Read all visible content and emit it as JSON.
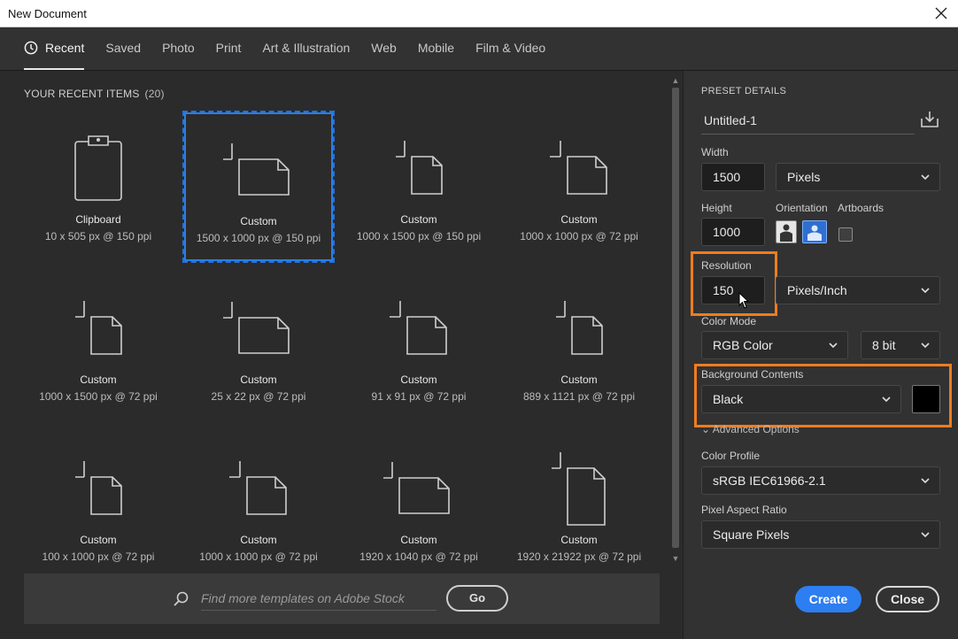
{
  "window": {
    "title": "New Document"
  },
  "tabs": [
    {
      "label": "Recent",
      "active": true
    },
    {
      "label": "Saved"
    },
    {
      "label": "Photo"
    },
    {
      "label": "Print"
    },
    {
      "label": "Art & Illustration"
    },
    {
      "label": "Web"
    },
    {
      "label": "Mobile"
    },
    {
      "label": "Film & Video"
    }
  ],
  "recent": {
    "heading": "YOUR RECENT ITEMS",
    "count": "(20)",
    "items": [
      {
        "name": "Clipboard",
        "meta": "10 x 505 px @ 150 ppi",
        "icon": "clipboard-icon"
      },
      {
        "name": "Custom",
        "meta": "1500 x 1000 px @ 150 ppi",
        "icon": "landscape-doc-icon",
        "selected": true
      },
      {
        "name": "Custom",
        "meta": "1000 x 1500 px @ 150 ppi",
        "icon": "portrait-doc-icon"
      },
      {
        "name": "Custom",
        "meta": "1000 x 1000 px @ 72 ppi",
        "icon": "square-doc-icon"
      },
      {
        "name": "Custom",
        "meta": "1000 x 1500 px @ 72 ppi",
        "icon": "portrait-doc-icon"
      },
      {
        "name": "Custom",
        "meta": "25 x 22 px @ 72 ppi",
        "icon": "landscape-doc-icon"
      },
      {
        "name": "Custom",
        "meta": "91 x 91 px @ 72 ppi",
        "icon": "square-doc-icon"
      },
      {
        "name": "Custom",
        "meta": "889 x 1121 px @ 72 ppi",
        "icon": "portrait-doc-icon"
      },
      {
        "name": "Custom",
        "meta": "100 x 1000 px @ 72 ppi",
        "icon": "portrait-doc-icon"
      },
      {
        "name": "Custom",
        "meta": "1000 x 1000 px @ 72 ppi",
        "icon": "square-doc-icon"
      },
      {
        "name": "Custom",
        "meta": "1920 x 1040 px @ 72 ppi",
        "icon": "landscape-doc-icon"
      },
      {
        "name": "Custom",
        "meta": "1920 x 21922 px @ 72 ppi",
        "icon": "tall-doc-icon"
      }
    ]
  },
  "search": {
    "placeholder": "Find more templates on Adobe Stock",
    "go_label": "Go"
  },
  "preset": {
    "heading": "PRESET DETAILS",
    "doc_name": "Untitled-1",
    "width_label": "Width",
    "width_value": "1500",
    "width_unit": "Pixels",
    "height_label": "Height",
    "height_value": "1000",
    "orientation_label": "Orientation",
    "artboards_label": "Artboards",
    "resolution_label": "Resolution",
    "resolution_value": "150",
    "resolution_unit": "Pixels/Inch",
    "color_mode_label": "Color Mode",
    "color_mode_value": "RGB Color",
    "bit_depth_value": "8 bit",
    "background_label": "Background Contents",
    "background_value": "Black",
    "background_swatch": "#000000",
    "advanced_label": "Advanced Options",
    "color_profile_label": "Color Profile",
    "color_profile_value": "sRGB IEC61966-2.1",
    "pixel_aspect_label": "Pixel Aspect Ratio",
    "pixel_aspect_value": "Square Pixels"
  },
  "actions": {
    "create_label": "Create",
    "close_label": "Close"
  },
  "colors": {
    "accent": "#2680eb",
    "highlight": "#f07c1e",
    "panel": "#323232"
  }
}
